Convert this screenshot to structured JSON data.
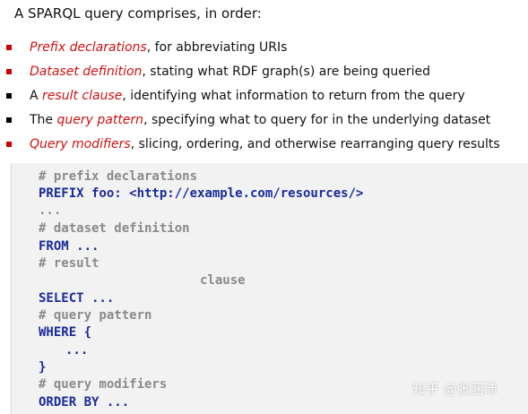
{
  "intro": "A SPARQL query comprises, in order:",
  "bullets": [
    {
      "highlight": "Prefix declarations",
      "rest": ", for abbreviating URIs",
      "prefix": ""
    },
    {
      "highlight": "Dataset definition",
      "rest": ", stating what RDF graph(s) are being queried",
      "prefix": ""
    },
    {
      "prefix": "A ",
      "highlight": "result clause",
      "rest": ", identifying what information to return from the query"
    },
    {
      "prefix": "The ",
      "highlight": "query pattern",
      "rest": ", specifying what to query for in the underlying dataset"
    },
    {
      "highlight": "Query modifiers",
      "rest": ", slicing, ordering, and otherwise rearranging query results",
      "prefix": ""
    }
  ],
  "code": {
    "line1": "# prefix declarations",
    "line2": "PREFIX foo: <http://example.com/resources/>",
    "line3": "...",
    "line4": "# dataset definition",
    "line5": "FROM ...",
    "line6": "# result",
    "line7": "clause",
    "line8": "SELECT ...",
    "line9": "# query pattern",
    "line10": "WHERE {",
    "line11": "...",
    "line12": "}",
    "line13": "# query modifiers",
    "line14": "ORDER BY ..."
  },
  "watermark": "知乎 @张涵沛",
  "colors": {
    "highlight": "#cc1111",
    "keyword": "#1a2a9a",
    "comment": "#8a8a8a",
    "code_background": "#f2f2f2"
  }
}
